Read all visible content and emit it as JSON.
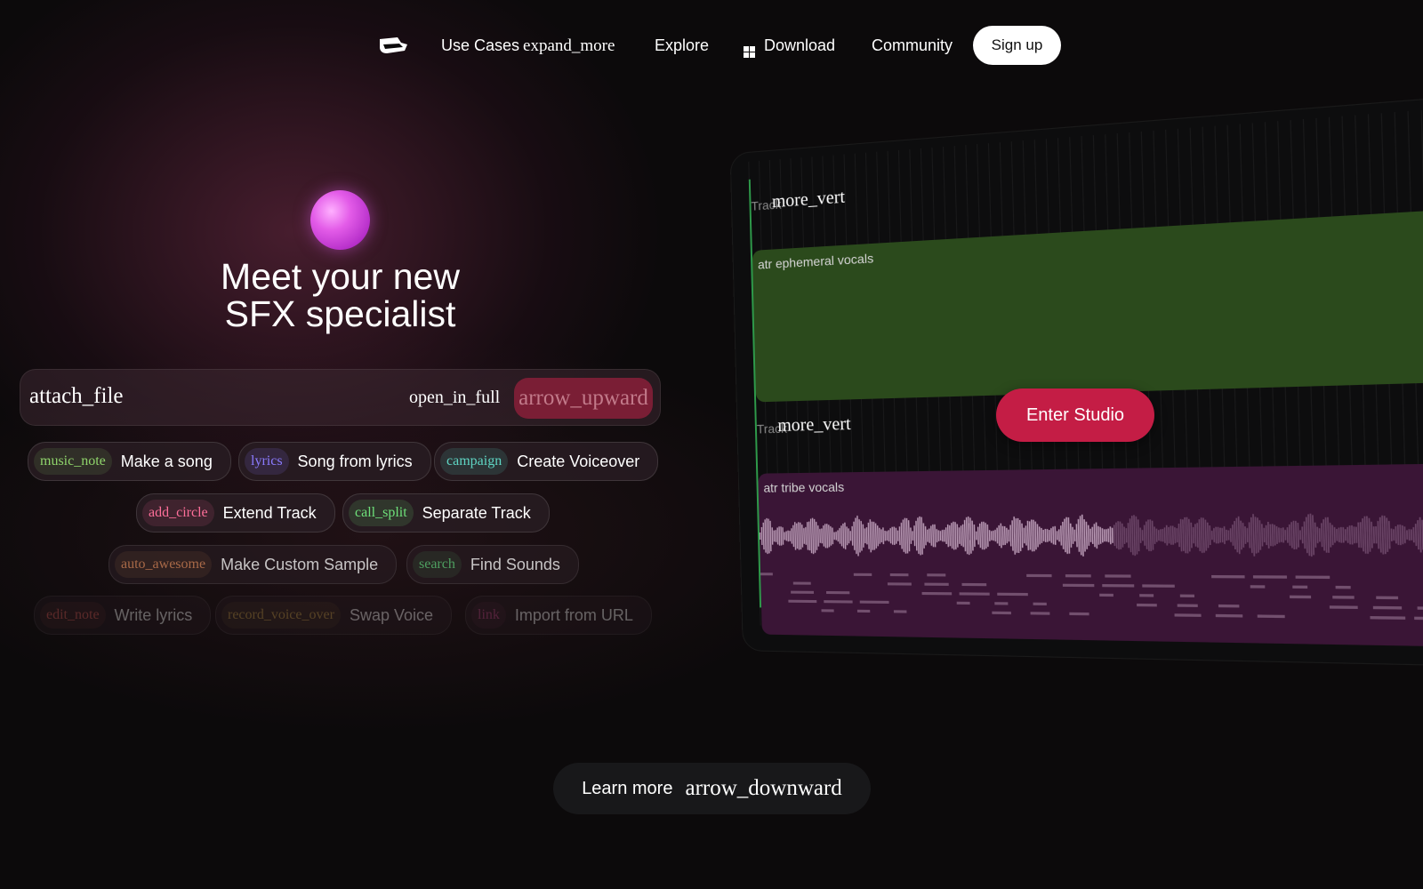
{
  "nav": {
    "use_cases": "Use Cases",
    "use_cases_icon": "expand_more",
    "explore": "Explore",
    "download": "Download",
    "community": "Community",
    "signup": "Sign up"
  },
  "hero": {
    "title_line1": "Meet your new",
    "title_line2": "SFX specialist"
  },
  "prompt": {
    "attach_icon": "attach_file",
    "fullscreen_icon": "open_in_full",
    "send_icon": "arrow_upward"
  },
  "chips": [
    {
      "icon": "music_note",
      "label": "Make a song",
      "color": "#8fd46b"
    },
    {
      "icon": "lyrics",
      "label": "Song from lyrics",
      "color": "#8b7bff"
    },
    {
      "icon": "campaign",
      "label": "Create Voiceover",
      "color": "#5fd6c4"
    },
    {
      "icon": "add_circle",
      "label": "Extend Track",
      "color": "#ff6f9a"
    },
    {
      "icon": "call_split",
      "label": "Separate Track",
      "color": "#6ee07a"
    },
    {
      "icon": "auto_awesome",
      "label": "Make Custom Sample",
      "color": "#d9885a"
    },
    {
      "icon": "search",
      "label": "Find Sounds",
      "color": "#5fcf7a"
    },
    {
      "icon": "edit_note",
      "label": "Write lyrics",
      "color": "#e0605a"
    },
    {
      "icon": "record_voice_over",
      "label": "Swap Voice",
      "color": "#c9a04a"
    },
    {
      "icon": "link",
      "label": "Import from URL",
      "color": "#c24a8a"
    }
  ],
  "studio": {
    "track1_label": "Track",
    "track2_label": "Track",
    "more_icon": "more_vert",
    "clip1_name": "atr ephemeral vocals",
    "clip2_name": "atr tribe vocals",
    "clip2_more_icon": "mor",
    "enter_studio": "Enter Studio"
  },
  "footer": {
    "learn_more": "Learn more",
    "learn_more_icon": "arrow_downward"
  }
}
